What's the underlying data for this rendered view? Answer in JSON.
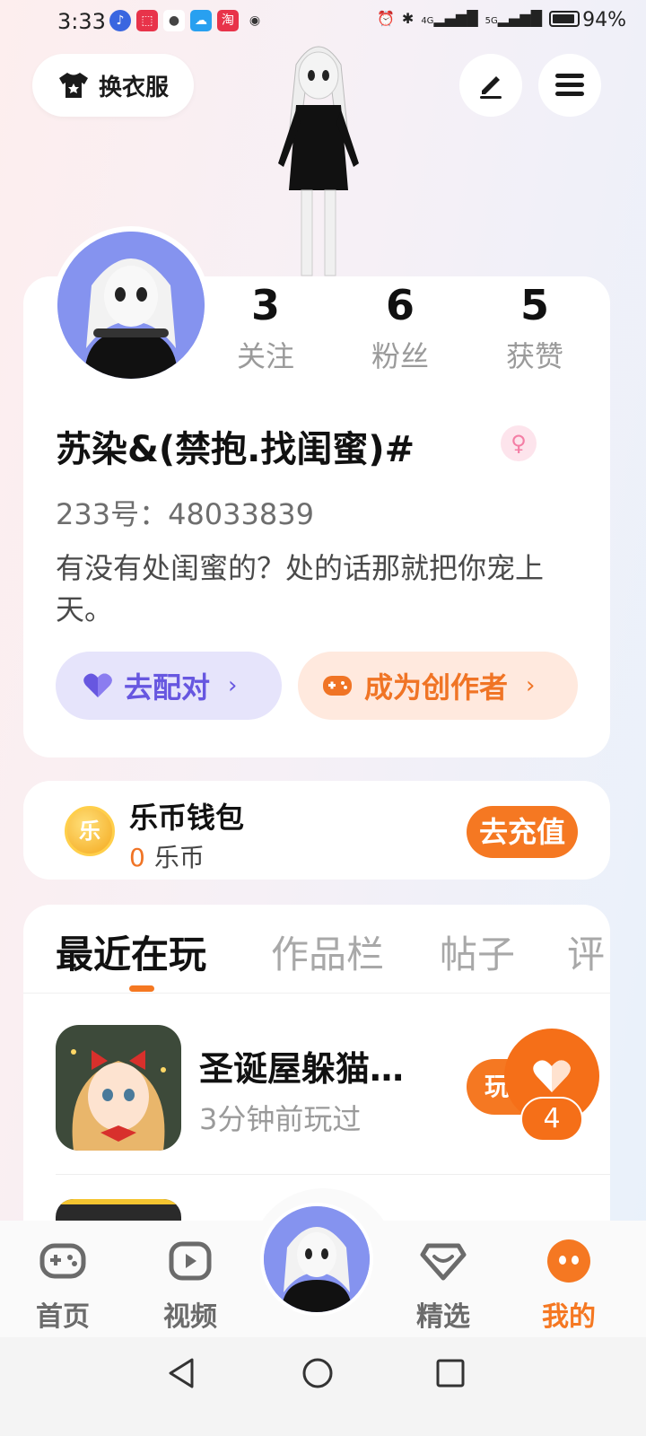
{
  "status_bar": {
    "time": "3:33",
    "network_1": "4G",
    "network_2": "5G",
    "battery": "94%"
  },
  "top_actions": {
    "outfit_label": "换衣服"
  },
  "profile": {
    "stats": [
      {
        "value": "3",
        "label": "关注"
      },
      {
        "value": "6",
        "label": "粉丝"
      },
      {
        "value": "5",
        "label": "获赞"
      }
    ],
    "nickname": "苏染&(禁抱.找闺蜜)#",
    "uid": "233号：48033839",
    "bio": "有没有处闺蜜的？处的话那就把你宠上天。",
    "pair_label": "去配对",
    "creator_label": "成为创作者"
  },
  "wallet": {
    "title": "乐币钱包",
    "coin_glyph": "乐",
    "balance": "0",
    "unit": "乐币",
    "recharge_label": "去充值"
  },
  "tabs": [
    "最近在玩",
    "作品栏",
    "帖子",
    "评"
  ],
  "recent_games": [
    {
      "title": "圣诞屋躲猫…",
      "time": "3分钟前玩过",
      "play_label": "玩"
    }
  ],
  "like_count": "4",
  "bottom_nav": [
    {
      "label": "首页",
      "icon": "gamepad-icon"
    },
    {
      "label": "视频",
      "icon": "video-icon"
    },
    {
      "label": "精选",
      "icon": "heart-gem-icon"
    },
    {
      "label": "我的",
      "icon": "face-icon"
    }
  ],
  "colors": {
    "accent": "#f57822",
    "pair": "#6757e0",
    "pair_bg": "#e6e4fb",
    "creator_bg": "#ffe9de"
  }
}
